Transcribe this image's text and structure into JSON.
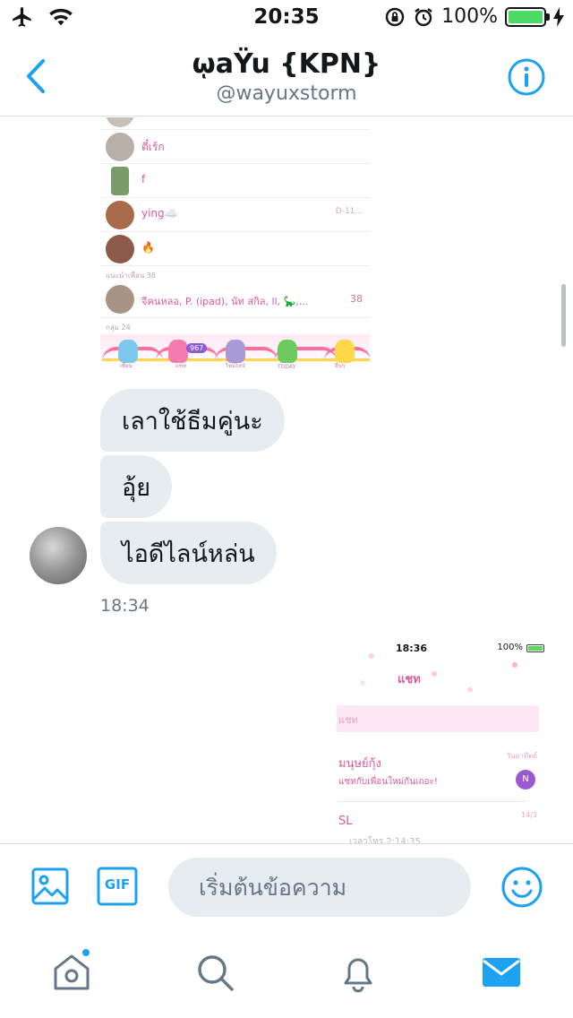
{
  "status_bar": {
    "time": "20:35",
    "battery": "100%",
    "battery_level": 1.0
  },
  "header": {
    "title": "ῳaŸu {KPN}",
    "handle": "@wayuxstorm"
  },
  "thread": {
    "shared_image_1": {
      "rows": [
        {
          "name": "ตี๋เร้ก",
          "meta": ""
        },
        {
          "name": "f",
          "meta": ""
        },
        {
          "name": "ying☁️",
          "meta": "D-11..."
        },
        {
          "name": "🔥",
          "meta": ""
        }
      ],
      "section_friends": "แนะนำเพื่อน 38",
      "group_row": {
        "name": "จีคนหลอ, P. (ipad), นัท สกิล, ll, 🦕,...",
        "count": "38"
      },
      "section_groups": "กลุ่ม 24",
      "banner_badge": "967",
      "banner_tabs": [
        "เพื่อน",
        "แชท",
        "ไทม์ไลน์",
        "TODAY",
        "อื่นๆ"
      ]
    },
    "messages": [
      {
        "text": "เลาใช้ธีมคู่นะ"
      },
      {
        "text": "อุ้ย"
      },
      {
        "text": "ไอดีไลน์หล่น"
      }
    ],
    "timestamp": "18:34",
    "shared_image_2": {
      "time": "18:36",
      "battery": "100%",
      "chat_title": "แชท",
      "search_placeholder": "แชท",
      "item1_name": "มนุษย์กุ้ง",
      "item1_desc": "แชทกับเพื่อนใหม่กันเถอะ!",
      "item1_meta": "วันอาทิตย์",
      "item1_badge": "N",
      "item2_name": "SL",
      "item2_meta": "14/3",
      "item2_desc": "เวลาโทร 2:14:35"
    }
  },
  "composer": {
    "placeholder": "เริ่มต้นข้อความ",
    "gif_label": "GIF"
  },
  "tabbar": {
    "items": [
      "home",
      "search",
      "notifications",
      "messages"
    ],
    "active": "messages"
  },
  "colors": {
    "accent": "#1da1f2",
    "bubble": "#e6ecf0",
    "muted": "#657786"
  }
}
